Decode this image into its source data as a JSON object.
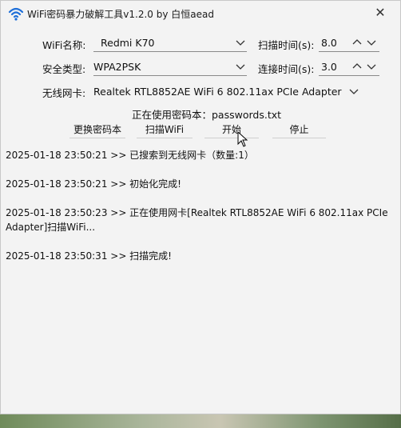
{
  "window": {
    "title": "WiFi密码暴力破解工具v1.2.0 by 白恒aead",
    "close_glyph": "✕"
  },
  "form": {
    "wifi_name_label": "WiFi名称:",
    "wifi_name_value": "Redmi K70",
    "scan_time_label": "扫描时间(s):",
    "scan_time_value": "8.0",
    "security_label": "安全类型:",
    "security_value": "WPA2PSK",
    "connect_time_label": "连接时间(s):",
    "connect_time_value": "3.0",
    "adapter_label": "无线网卡:",
    "adapter_value": "Realtek RTL8852AE WiFi 6 802.11ax PCIe Adapter"
  },
  "current_dict": "正在使用密码本：passwords.txt",
  "buttons": {
    "change_dict": "更换密码本",
    "scan_wifi": "扫描WiFi",
    "start": "开始",
    "stop": "停止"
  },
  "log": [
    "2025-01-18 23:50:21 >> 已搜索到无线网卡（数量:1）",
    "2025-01-18 23:50:21 >> 初始化完成!",
    "2025-01-18 23:50:23 >> 正在使用网卡[Realtek RTL8852AE WiFi 6 802.11ax PCIe Adapter]扫描WiFi...",
    "2025-01-18 23:50:31 >> 扫描完成!"
  ],
  "icons": {
    "app": "wifi-icon",
    "chevron": "chevron-down-icon",
    "spin_up": "chevron-up-icon",
    "close": "close-icon"
  },
  "colors": {
    "window_bg": "#f3f3f3",
    "wifi_icon": "#1e6fd9"
  }
}
